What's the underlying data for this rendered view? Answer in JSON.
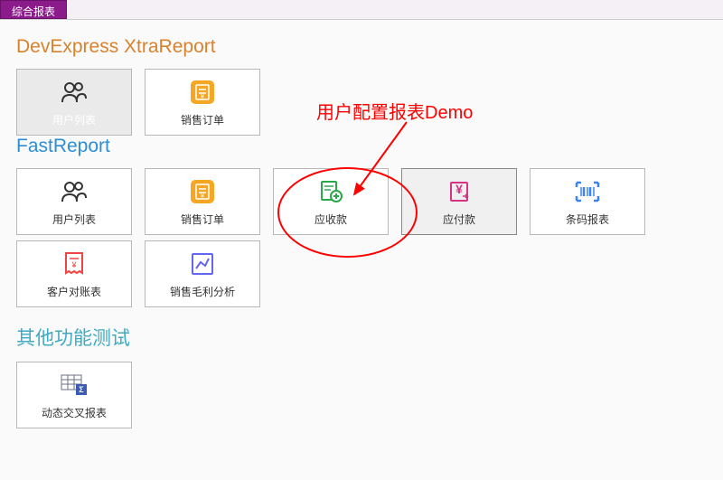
{
  "tab": {
    "label": "综合报表"
  },
  "sections": {
    "devexpress": {
      "title": "DevExpress XtraReport"
    },
    "fastreport": {
      "title": "FastReport"
    },
    "other": {
      "title": "其他功能测试"
    }
  },
  "tiles": {
    "de_userlist": "用户列表",
    "de_salesorder": "销售订单",
    "fr_userlist": "用户列表",
    "fr_salesorder": "销售订单",
    "fr_receivable": "应收款",
    "fr_payable": "应付款",
    "fr_barcode": "条码报表",
    "fr_statement": "客户对账表",
    "fr_profit": "销售毛利分析",
    "other_pivot": "动态交叉报表"
  },
  "annotation": {
    "text": "用户配置报表Demo"
  }
}
